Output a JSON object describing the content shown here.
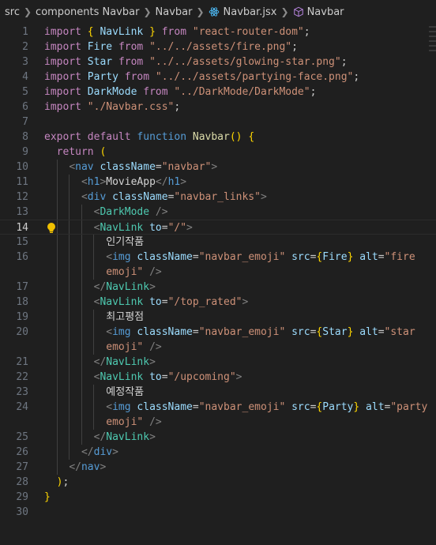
{
  "breadcrumb": {
    "items": [
      "src",
      "components Navbar",
      "Navbar",
      "Navbar.jsx",
      "Navbar"
    ],
    "icons": [
      "chevron-right-icon",
      "react-icon",
      "cube-icon"
    ]
  },
  "editor": {
    "current_line": 14,
    "lines": [
      {
        "n": "1",
        "text": "import { NavLink } from \"react-router-dom\";"
      },
      {
        "n": "2",
        "text": "import Fire from \"../../assets/fire.png\";"
      },
      {
        "n": "3",
        "text": "import Star from \"../../assets/glowing-star.png\";"
      },
      {
        "n": "4",
        "text": "import Party from \"../../assets/partying-face.png\";"
      },
      {
        "n": "5",
        "text": "import DarkMode from \"../DarkMode/DarkMode\";"
      },
      {
        "n": "6",
        "text": "import \"./Navbar.css\";"
      },
      {
        "n": "7",
        "text": ""
      },
      {
        "n": "8",
        "text": "export default function Navbar() {"
      },
      {
        "n": "9",
        "text": "  return ("
      },
      {
        "n": "10",
        "text": "    <nav className=\"navbar\">"
      },
      {
        "n": "11",
        "text": "      <h1>MovieApp</h1>"
      },
      {
        "n": "12",
        "text": "      <div className=\"navbar_links\">"
      },
      {
        "n": "13",
        "text": "        <DarkMode />"
      },
      {
        "n": "14",
        "text": "        <NavLink to=\"/\">"
      },
      {
        "n": "15",
        "text": "          인기작품"
      },
      {
        "n": "16",
        "text": "          <img className=\"navbar_emoji\" src={Fire} alt=\"fire"
      },
      {
        "n": "",
        "text": "          emoji\" />"
      },
      {
        "n": "17",
        "text": "        </NavLink>"
      },
      {
        "n": "18",
        "text": "        <NavLink to=\"/top_rated\">"
      },
      {
        "n": "19",
        "text": "          최고평점"
      },
      {
        "n": "20",
        "text": "          <img className=\"navbar_emoji\" src={Star} alt=\"star"
      },
      {
        "n": "",
        "text": "          emoji\" />"
      },
      {
        "n": "21",
        "text": "        </NavLink>"
      },
      {
        "n": "22",
        "text": "        <NavLink to=\"/upcoming\">"
      },
      {
        "n": "23",
        "text": "          예정작품"
      },
      {
        "n": "24",
        "text": "          <img className=\"navbar_emoji\" src={Party} alt=\"party"
      },
      {
        "n": "",
        "text": "          emoji\" />"
      },
      {
        "n": "25",
        "text": "        </NavLink>"
      },
      {
        "n": "26",
        "text": "      </div>"
      },
      {
        "n": "27",
        "text": "    </nav>"
      },
      {
        "n": "28",
        "text": "  );"
      },
      {
        "n": "29",
        "text": "}"
      },
      {
        "n": "30",
        "text": ""
      }
    ]
  },
  "colors": {
    "background": "#1f1f1f",
    "keyword": "#c586c0",
    "string": "#ce9178",
    "tag": "#569cd6",
    "component": "#4ec9b0",
    "attribute": "#9cdcfe",
    "function": "#dcdcaa",
    "lightbulb": "#f0c000"
  }
}
